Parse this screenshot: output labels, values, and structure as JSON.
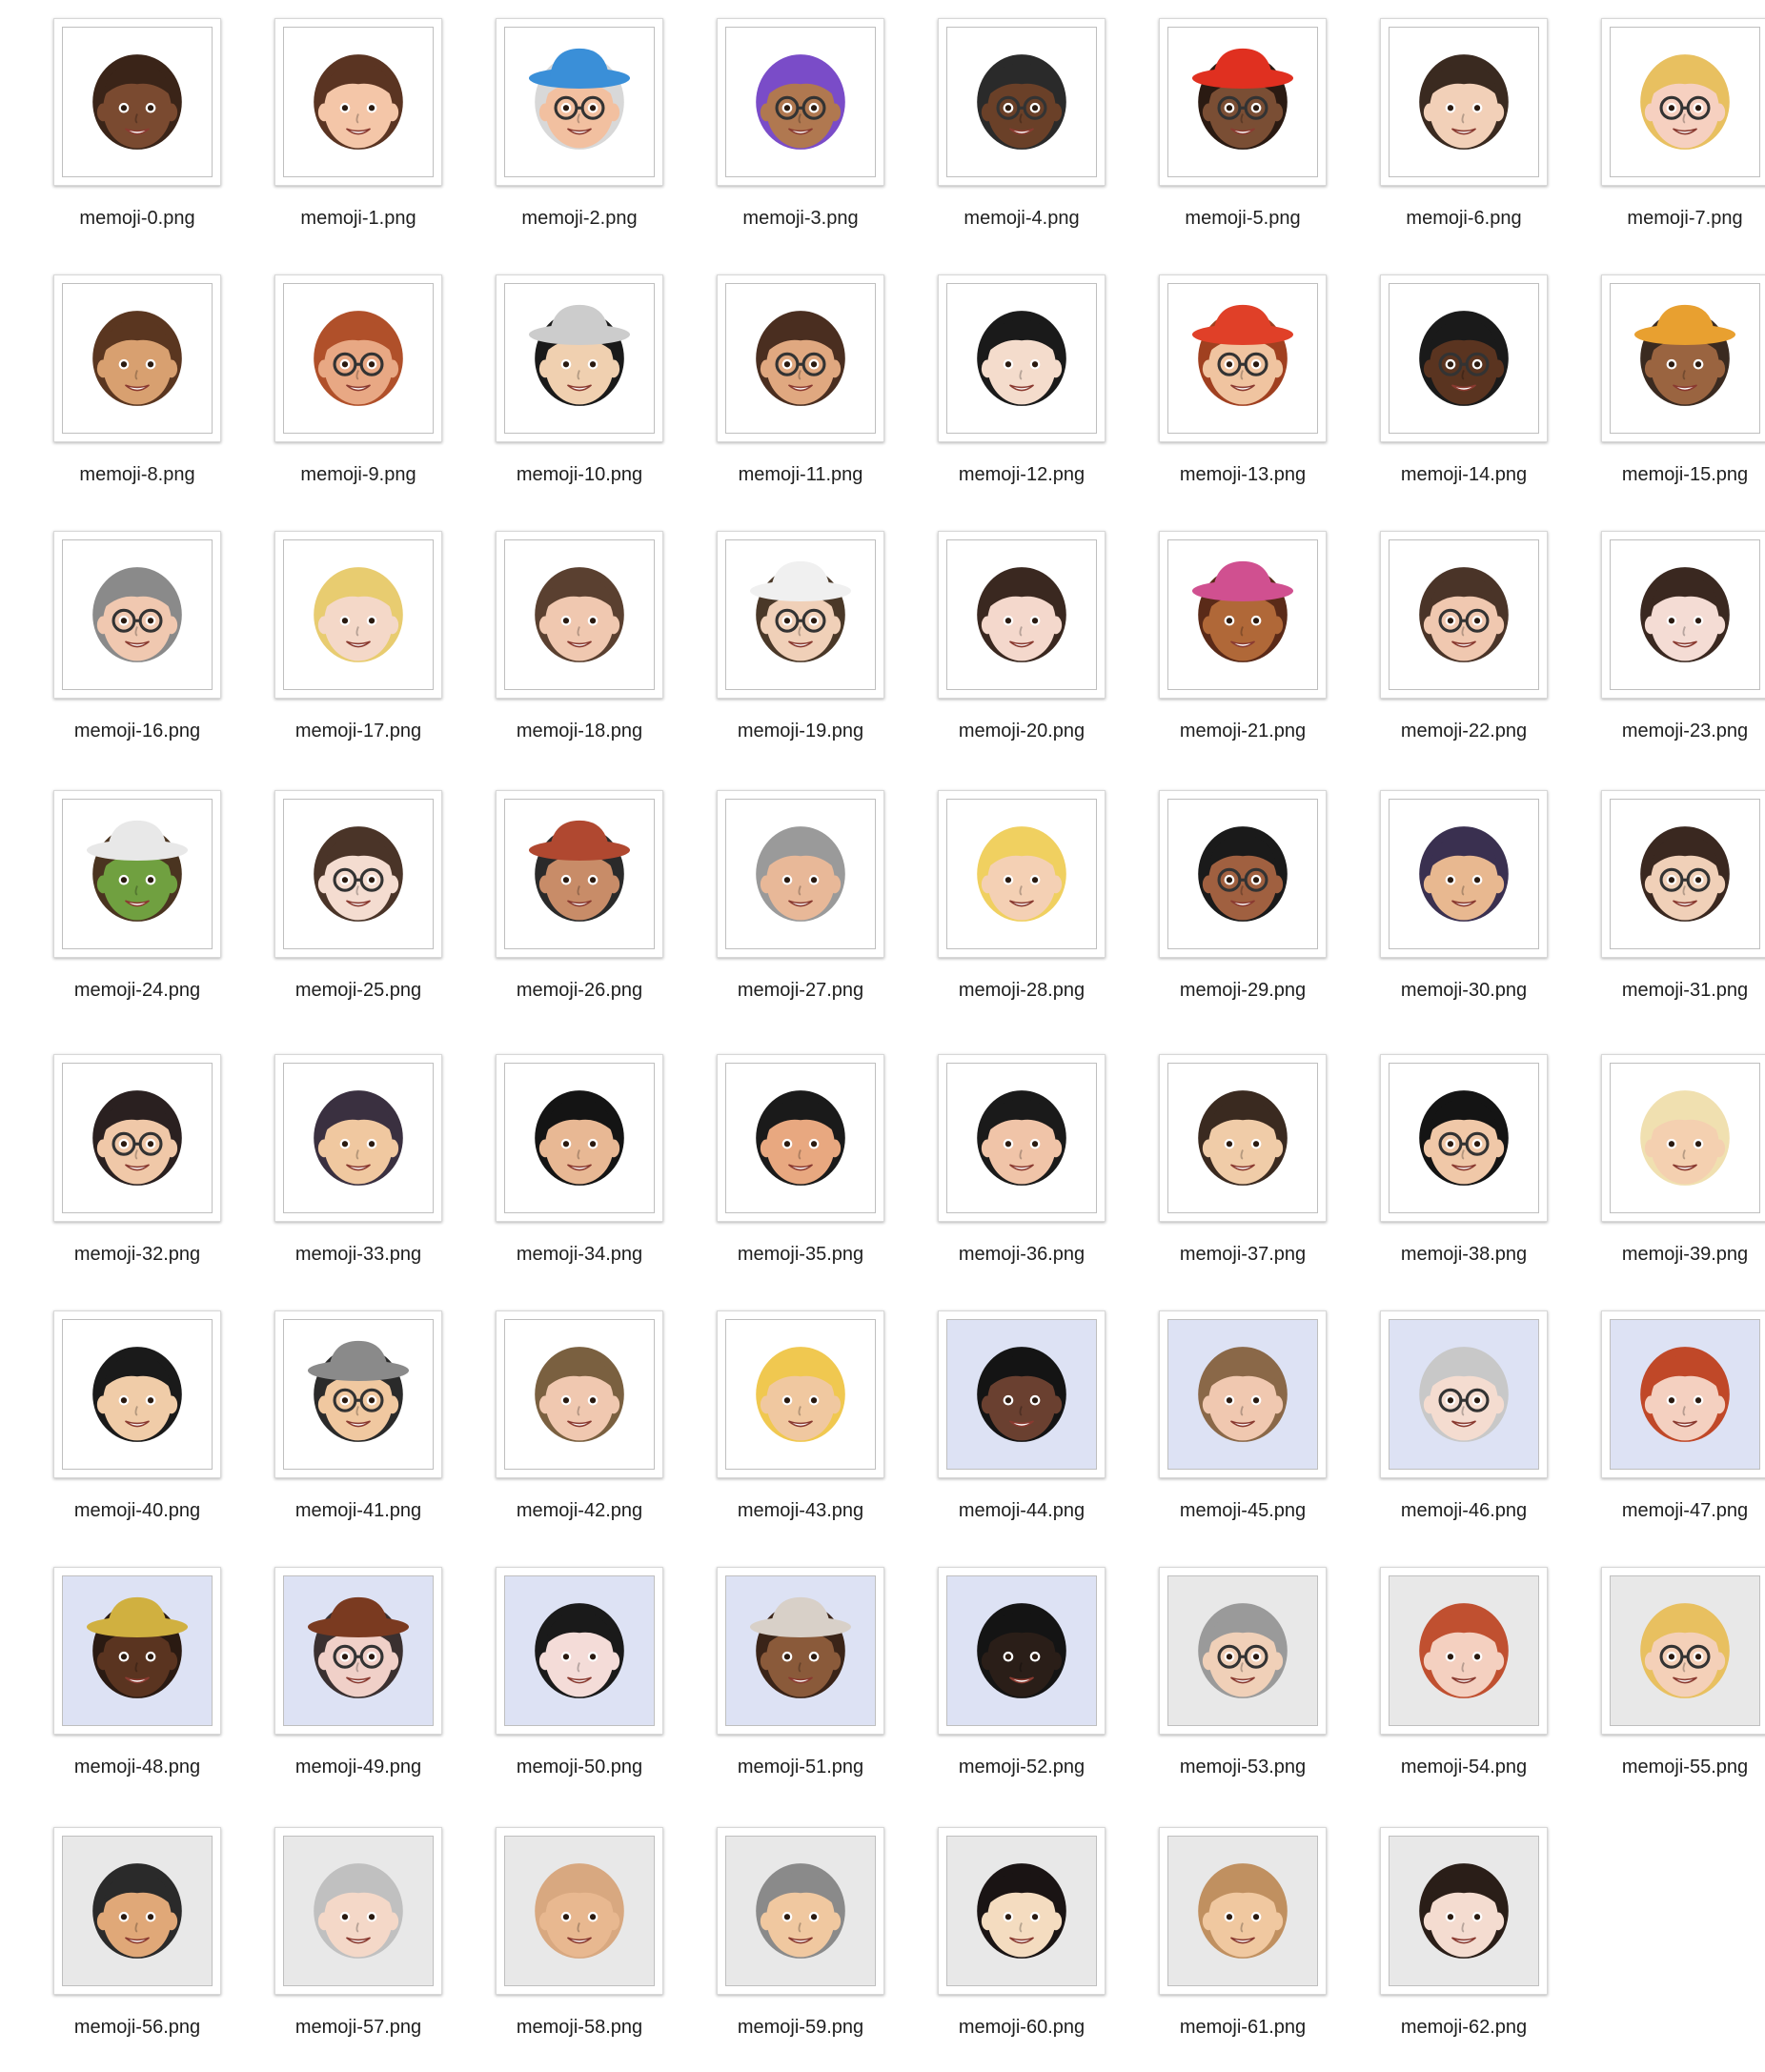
{
  "files": [
    {
      "name": "memoji-0.png",
      "bg": "#ffffff",
      "skin": "#7a4a30",
      "hair": "#3a2418",
      "hat": "",
      "glasses": false
    },
    {
      "name": "memoji-1.png",
      "bg": "#ffffff",
      "skin": "#f4c6a8",
      "hair": "#5a3422",
      "hat": "",
      "glasses": false
    },
    {
      "name": "memoji-2.png",
      "bg": "#ffffff",
      "skin": "#f2c0a0",
      "hair": "#d8d8d8",
      "hat": "#3a8fd8",
      "glasses": true
    },
    {
      "name": "memoji-3.png",
      "bg": "#ffffff",
      "skin": "#b07850",
      "hair": "#7a4cc8",
      "hat": "",
      "glasses": true
    },
    {
      "name": "memoji-4.png",
      "bg": "#ffffff",
      "skin": "#6a4028",
      "hair": "#2a2a2a",
      "hat": "",
      "glasses": true
    },
    {
      "name": "memoji-5.png",
      "bg": "#ffffff",
      "skin": "#7a4e34",
      "hair": "#2a1a12",
      "hat": "#e03020",
      "glasses": true
    },
    {
      "name": "memoji-6.png",
      "bg": "#ffffff",
      "skin": "#f2d0b8",
      "hair": "#3a2a20",
      "hat": "",
      "glasses": false
    },
    {
      "name": "memoji-7.png",
      "bg": "#ffffff",
      "skin": "#f6d0c0",
      "hair": "#e8c060",
      "hat": "",
      "glasses": true
    },
    {
      "name": "memoji-8.png",
      "bg": "#ffffff",
      "skin": "#d8a070",
      "hair": "#5a3620",
      "hat": "",
      "glasses": false
    },
    {
      "name": "memoji-9.png",
      "bg": "#ffffff",
      "skin": "#e8a884",
      "hair": "#b0502a",
      "hat": "",
      "glasses": true
    },
    {
      "name": "memoji-10.png",
      "bg": "#ffffff",
      "skin": "#f0d0b0",
      "hair": "#1a1a1a",
      "hat": "#cccccc",
      "glasses": false
    },
    {
      "name": "memoji-11.png",
      "bg": "#ffffff",
      "skin": "#e0a880",
      "hair": "#4a2e20",
      "hat": "",
      "glasses": true
    },
    {
      "name": "memoji-12.png",
      "bg": "#ffffff",
      "skin": "#f4dccc",
      "hair": "#1a1a1a",
      "hat": "",
      "glasses": false
    },
    {
      "name": "memoji-13.png",
      "bg": "#ffffff",
      "skin": "#f0c4a0",
      "hair": "#a04020",
      "hat": "#e04028",
      "glasses": true
    },
    {
      "name": "memoji-14.png",
      "bg": "#ffffff",
      "skin": "#5a3420",
      "hair": "#1a1a1a",
      "hat": "",
      "glasses": true
    },
    {
      "name": "memoji-15.png",
      "bg": "#ffffff",
      "skin": "#9a6440",
      "hair": "#3a2a20",
      "hat": "#e8a030",
      "glasses": false
    },
    {
      "name": "memoji-16.png",
      "bg": "#ffffff",
      "skin": "#f0c8b0",
      "hair": "#8a8a8a",
      "hat": "",
      "glasses": true
    },
    {
      "name": "memoji-17.png",
      "bg": "#ffffff",
      "skin": "#f4d8c8",
      "hair": "#e8cc70",
      "hat": "",
      "glasses": false
    },
    {
      "name": "memoji-18.png",
      "bg": "#ffffff",
      "skin": "#f0c8b0",
      "hair": "#5a4030",
      "hat": "",
      "glasses": false
    },
    {
      "name": "memoji-19.png",
      "bg": "#ffffff",
      "skin": "#f0d0b8",
      "hair": "#4a3828",
      "hat": "#f0f0f0",
      "glasses": true
    },
    {
      "name": "memoji-20.png",
      "bg": "#ffffff",
      "skin": "#f4d8cc",
      "hair": "#3a2820",
      "hat": "",
      "glasses": false
    },
    {
      "name": "memoji-21.png",
      "bg": "#ffffff",
      "skin": "#b06838",
      "hair": "#5a2a18",
      "hat": "#d05090",
      "glasses": false
    },
    {
      "name": "memoji-22.png",
      "bg": "#ffffff",
      "skin": "#f0c8b0",
      "hair": "#4a3428",
      "hat": "",
      "glasses": true
    },
    {
      "name": "memoji-23.png",
      "bg": "#ffffff",
      "skin": "#f4dcd4",
      "hair": "#3a2820",
      "hat": "",
      "glasses": false
    },
    {
      "name": "memoji-24.png",
      "bg": "#ffffff",
      "skin": "#70a040",
      "hair": "#4a3420",
      "hat": "#e8e8e8",
      "glasses": false
    },
    {
      "name": "memoji-25.png",
      "bg": "#ffffff",
      "skin": "#f4dcd0",
      "hair": "#4a3428",
      "hat": "",
      "glasses": true
    },
    {
      "name": "memoji-26.png",
      "bg": "#ffffff",
      "skin": "#c88c68",
      "hair": "#2a2a2a",
      "hat": "#b04830",
      "glasses": false
    },
    {
      "name": "memoji-27.png",
      "bg": "#ffffff",
      "skin": "#e8b898",
      "hair": "#9a9a9a",
      "hat": "",
      "glasses": false
    },
    {
      "name": "memoji-28.png",
      "bg": "#ffffff",
      "skin": "#f4d0b4",
      "hair": "#f0d060",
      "hat": "",
      "glasses": false
    },
    {
      "name": "memoji-29.png",
      "bg": "#ffffff",
      "skin": "#a06040",
      "hair": "#1a1a1a",
      "hat": "",
      "glasses": true
    },
    {
      "name": "memoji-30.png",
      "bg": "#ffffff",
      "skin": "#e8b890",
      "hair": "#3a3050",
      "hat": "",
      "glasses": false
    },
    {
      "name": "memoji-31.png",
      "bg": "#ffffff",
      "skin": "#f0d0b8",
      "hair": "#3a2820",
      "hat": "",
      "glasses": true
    },
    {
      "name": "memoji-32.png",
      "bg": "#ffffff",
      "skin": "#f0c8a8",
      "hair": "#2a2020",
      "hat": "",
      "glasses": true
    },
    {
      "name": "memoji-33.png",
      "bg": "#ffffff",
      "skin": "#f0c8a0",
      "hair": "#3a3040",
      "hat": "",
      "glasses": false
    },
    {
      "name": "memoji-34.png",
      "bg": "#ffffff",
      "skin": "#e8b894",
      "hair": "#141414",
      "hat": "",
      "glasses": false
    },
    {
      "name": "memoji-35.png",
      "bg": "#ffffff",
      "skin": "#e8a880",
      "hair": "#1a1a1a",
      "hat": "",
      "glasses": false
    },
    {
      "name": "memoji-36.png",
      "bg": "#ffffff",
      "skin": "#f0c4a8",
      "hair": "#1a1a1a",
      "hat": "",
      "glasses": false
    },
    {
      "name": "memoji-37.png",
      "bg": "#ffffff",
      "skin": "#f0cca8",
      "hair": "#3a2a20",
      "hat": "",
      "glasses": false
    },
    {
      "name": "memoji-38.png",
      "bg": "#ffffff",
      "skin": "#f0c8a8",
      "hair": "#141414",
      "hat": "",
      "glasses": true
    },
    {
      "name": "memoji-39.png",
      "bg": "#ffffff",
      "skin": "#f4d0b0",
      "hair": "#f0e0b0",
      "hat": "",
      "glasses": false
    },
    {
      "name": "memoji-40.png",
      "bg": "#ffffff",
      "skin": "#f0cca8",
      "hair": "#1a1a1a",
      "hat": "",
      "glasses": false
    },
    {
      "name": "memoji-41.png",
      "bg": "#ffffff",
      "skin": "#f0c8a0",
      "hair": "#2a2a2a",
      "hat": "#8a8a8a",
      "glasses": true
    },
    {
      "name": "memoji-42.png",
      "bg": "#ffffff",
      "skin": "#f0c8b0",
      "hair": "#7a6040",
      "hat": "",
      "glasses": false
    },
    {
      "name": "memoji-43.png",
      "bg": "#ffffff",
      "skin": "#f0c8a0",
      "hair": "#f0c850",
      "hat": "",
      "glasses": false
    },
    {
      "name": "memoji-44.png",
      "bg": "#dde2f4",
      "skin": "#6a4030",
      "hair": "#141414",
      "hat": "",
      "glasses": false
    },
    {
      "name": "memoji-45.png",
      "bg": "#dde2f4",
      "skin": "#f0c8b0",
      "hair": "#8a6848",
      "hat": "",
      "glasses": false
    },
    {
      "name": "memoji-46.png",
      "bg": "#dde2f4",
      "skin": "#f4dcd0",
      "hair": "#c8c8c8",
      "hat": "",
      "glasses": true
    },
    {
      "name": "memoji-47.png",
      "bg": "#dde2f4",
      "skin": "#f4d0c0",
      "hair": "#c04828",
      "hat": "",
      "glasses": false
    },
    {
      "name": "memoji-48.png",
      "bg": "#dde2f4",
      "skin": "#5a3420",
      "hair": "#2a1a12",
      "hat": "#d0b040",
      "glasses": false
    },
    {
      "name": "memoji-49.png",
      "bg": "#dde2f4",
      "skin": "#f0d0c8",
      "hair": "#3a3030",
      "hat": "#7a3a20",
      "glasses": true
    },
    {
      "name": "memoji-50.png",
      "bg": "#dde2f4",
      "skin": "#f4dcd8",
      "hair": "#1a1a1a",
      "hat": "",
      "glasses": false
    },
    {
      "name": "memoji-51.png",
      "bg": "#dde2f4",
      "skin": "#8a5a3a",
      "hair": "#3a2418",
      "hat": "#d8d0c8",
      "glasses": false
    },
    {
      "name": "memoji-52.png",
      "bg": "#dde2f4",
      "skin": "#2a1e18",
      "hair": "#141414",
      "hat": "",
      "glasses": false
    },
    {
      "name": "memoji-53.png",
      "bg": "#e8e8e8",
      "skin": "#f0d0b8",
      "hair": "#9a9a9a",
      "hat": "",
      "glasses": true
    },
    {
      "name": "memoji-54.png",
      "bg": "#e8e8e8",
      "skin": "#f4d0c0",
      "hair": "#c05030",
      "hat": "",
      "glasses": false
    },
    {
      "name": "memoji-55.png",
      "bg": "#e8e8e8",
      "skin": "#f4d0b8",
      "hair": "#e8c060",
      "hat": "",
      "glasses": true
    },
    {
      "name": "memoji-56.png",
      "bg": "#e8e8e8",
      "skin": "#e0a878",
      "hair": "#2a2a2a",
      "hat": "",
      "glasses": false
    },
    {
      "name": "memoji-57.png",
      "bg": "#e8e8e8",
      "skin": "#f4d8c8",
      "hair": "#c0c0c0",
      "hat": "",
      "glasses": false
    },
    {
      "name": "memoji-58.png",
      "bg": "#e8e8e8",
      "skin": "#e8b890",
      "hair": "#d8a880",
      "hat": "",
      "glasses": false
    },
    {
      "name": "memoji-59.png",
      "bg": "#e8e8e8",
      "skin": "#f0c8a0",
      "hair": "#8a8a8a",
      "hat": "",
      "glasses": false
    },
    {
      "name": "memoji-60.png",
      "bg": "#e8e8e8",
      "skin": "#f4dcc0",
      "hair": "#1a1414",
      "hat": "",
      "glasses": false
    },
    {
      "name": "memoji-61.png",
      "bg": "#e8e8e8",
      "skin": "#f0c8a0",
      "hair": "#c09060",
      "hat": "",
      "glasses": false
    },
    {
      "name": "memoji-62.png",
      "bg": "#e8e8e8",
      "skin": "#f4dcd0",
      "hair": "#2a1e18",
      "hat": "",
      "glasses": false
    }
  ]
}
